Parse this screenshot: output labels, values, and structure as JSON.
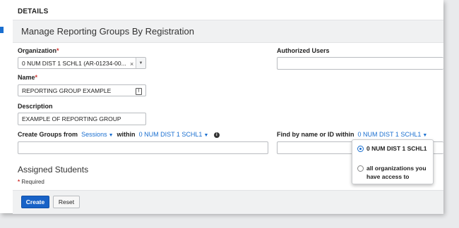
{
  "section": {
    "title": "DETAILS"
  },
  "header": {
    "title": "Manage Reporting Groups By Registration"
  },
  "organization": {
    "label": "Organization",
    "required_mark": "*",
    "value": "0 NUM DIST 1 SCHL1 (AR-01234-00...",
    "clear_glyph": "×",
    "arrow_glyph": "▼"
  },
  "authorized_users": {
    "label": "Authorized Users",
    "value": ""
  },
  "name": {
    "label": "Name",
    "required_mark": "*",
    "value": "REPORTING GROUP EXAMPLE",
    "icon": "!"
  },
  "description": {
    "label": "Description",
    "value": "EXAMPLE OF REPORTING GROUP"
  },
  "create_groups": {
    "label": "Create Groups from",
    "source": "Sessions",
    "within": "within",
    "scope": "0 NUM DIST 1 SCHL1",
    "info": "i",
    "value": ""
  },
  "find": {
    "label": "Find by name or ID within",
    "scope": "0 NUM DIST 1 SCHL1",
    "value": ""
  },
  "scope_dropdown": {
    "options": [
      {
        "label": "0 NUM DIST 1 SCHL1",
        "selected": true
      },
      {
        "label": "all organizations you have access to",
        "selected": false
      }
    ]
  },
  "assigned": {
    "title": "Assigned Students"
  },
  "required_note": {
    "mark": "*",
    "text": " Required"
  },
  "footer": {
    "create_label": "Create",
    "reset_label": "Reset"
  },
  "colors": {
    "accent": "#1a6fd0",
    "primary_button": "#1862c7",
    "required": "#d0312d"
  }
}
